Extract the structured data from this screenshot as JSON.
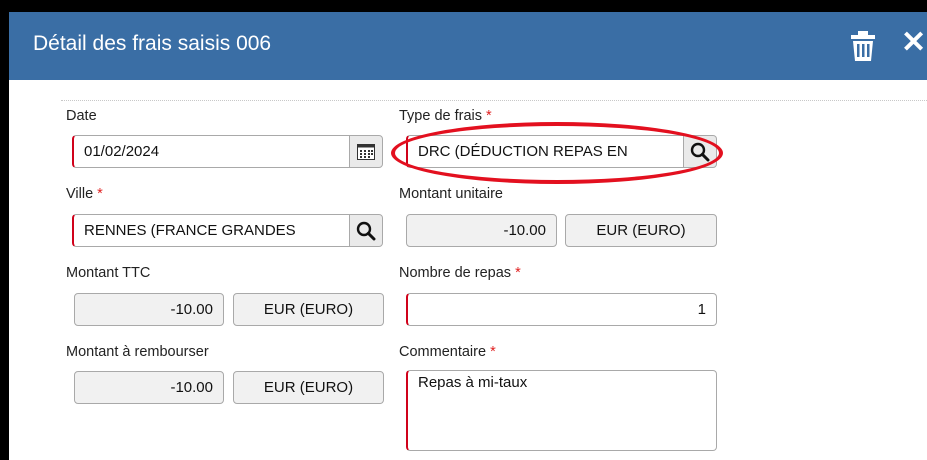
{
  "dialog": {
    "title": "Détail des frais saisis 006",
    "icons": {
      "delete": "trash-icon",
      "close": "close-icon"
    }
  },
  "form": {
    "date": {
      "label": "Date",
      "value": "01/02/2024"
    },
    "type_frais": {
      "label": "Type de frais",
      "required_mark": "*",
      "value": "DRC (DÉDUCTION REPAS EN"
    },
    "ville": {
      "label": "Ville",
      "required_mark": "*",
      "value": "RENNES (FRANCE GRANDES"
    },
    "montant_unitaire": {
      "label": "Montant unitaire",
      "value": "-10.00",
      "currency": "EUR (EURO)"
    },
    "montant_ttc": {
      "label": "Montant TTC",
      "value": "-10.00",
      "currency": "EUR (EURO)"
    },
    "nombre_repas": {
      "label": "Nombre de repas",
      "required_mark": "*",
      "value": "1"
    },
    "montant_rembourser": {
      "label": "Montant à rembourser",
      "value": "-10.00",
      "currency": "EUR (EURO)"
    },
    "commentaire": {
      "label": "Commentaire",
      "required_mark": "*",
      "value": "Repas à mi-taux"
    }
  },
  "colors": {
    "header": "#3a6ea5",
    "required": "#d0021b",
    "highlight": "#e3101f"
  }
}
